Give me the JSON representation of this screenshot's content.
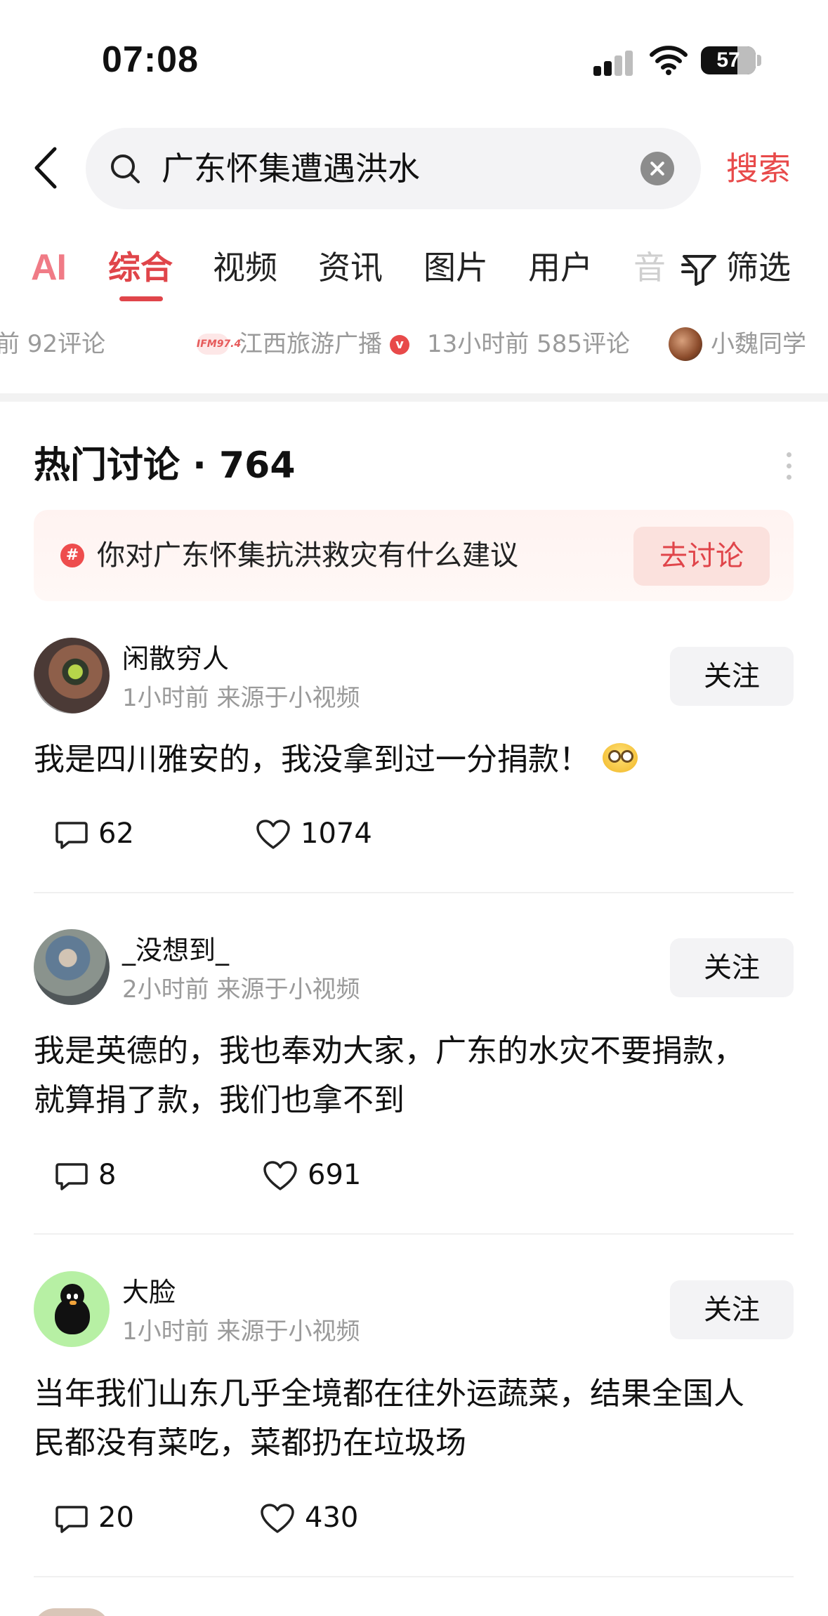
{
  "status_bar": {
    "time": "07:08",
    "battery": "57"
  },
  "search": {
    "query": "广东怀集遭遇洪水",
    "button_label": "搜索"
  },
  "tabs": [
    {
      "label": "AI"
    },
    {
      "label": "综合"
    },
    {
      "label": "视频"
    },
    {
      "label": "资讯"
    },
    {
      "label": "图片"
    },
    {
      "label": "用户"
    },
    {
      "label": "音"
    }
  ],
  "filter_label": "筛选",
  "sources_strip": {
    "item1_comments": "前  92评论",
    "item2_name": "江西旅游广播",
    "item2_meta": "13小时前   585评论",
    "item3_name": "小魏同学",
    "ifm_logo": "IFM97.4"
  },
  "hot_discussion": {
    "title": "热门讨论 · 764",
    "suggest_text": "你对广东怀集抗洪救灾有什么建议",
    "discuss_button": "去讨论",
    "topic_icon": "#"
  },
  "posts": [
    {
      "username": "闲散穷人",
      "meta": "1小时前  来源于小视频",
      "follow_label": "关注",
      "content": "我是四川雅安的，我没拿到过一分捐款！",
      "comments": "62",
      "likes": "1074"
    },
    {
      "username": "_没想到_",
      "meta": "2小时前  来源于小视频",
      "follow_label": "关注",
      "content_line1": "我是英德的，我也奉劝大家，广东的水灾不要捐款，",
      "content_line2": "就算捐了款，我们也拿不到",
      "comments": "8",
      "likes": "691"
    },
    {
      "username": "大脸",
      "meta": "1小时前  来源于小视频",
      "follow_label": "关注",
      "content_line1": "当年我们山东几乎全境都在往外运蔬菜，结果全国人",
      "content_line2": "民都没有菜吃，菜都扔在垃圾场",
      "comments": "20",
      "likes": "430"
    }
  ],
  "colors": {
    "accent": "#e0454a",
    "search_bg": "#f3f3f5",
    "meta_gray": "#9a9a9a",
    "suggest_bg": "#fff3f1"
  },
  "icons": [
    "back-icon",
    "search-icon",
    "clear-icon",
    "filter-icon",
    "comment-icon",
    "like-icon",
    "more-icon",
    "verified-icon",
    "topic-icon"
  ]
}
